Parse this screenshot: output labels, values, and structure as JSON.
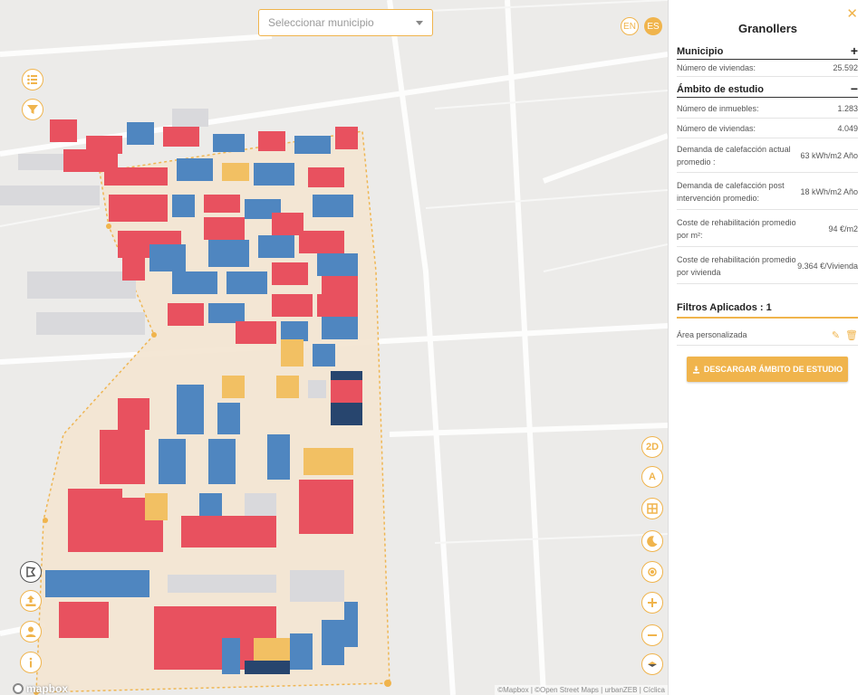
{
  "map": {
    "municipality_select": {
      "placeholder": "Seleccionar municipio"
    },
    "lang": {
      "en": "EN",
      "es": "ES"
    },
    "controls_right": {
      "mode_2d": "2D",
      "label_a": "A"
    },
    "logo": "mapbox",
    "attribution": "©Mapbox | ©Open Street Maps | urbanZEB | Cíclica",
    "building_colors": {
      "red": "#e8515f",
      "blue": "#4f86c0",
      "yellow": "#f2c063",
      "gray": "#d8d8dc",
      "darkblue": "#27456e"
    },
    "accent": "#f0b44c"
  },
  "panel": {
    "title": "Granollers",
    "municipio": {
      "heading": "Municipio",
      "toggle": "+",
      "rows": [
        {
          "label": "Número de viviendas:",
          "value": "25.592"
        }
      ]
    },
    "ambito": {
      "heading": "Ámbito de estudio",
      "toggle": "−",
      "rows": [
        {
          "label": "Número de inmuebles:",
          "value": "1.283"
        },
        {
          "label": "Número de viviendas:",
          "value": "4.049"
        },
        {
          "label": "Demanda de calefacción actual promedio :",
          "value": "63 kWh/m2  Año"
        },
        {
          "label": "Demanda de calefacción post intervención promedio:",
          "value": "18 kWh/m2  Año"
        },
        {
          "label": "Coste de rehabilitación promedio por m²:",
          "value": "94 €/m2"
        },
        {
          "label": "Coste de rehabilitación promedio por vivienda",
          "value": "9.364 €/Vivienda"
        }
      ]
    },
    "filters": {
      "heading": "Filtros Aplicados : 1",
      "items": [
        {
          "label": "Área personalizada"
        }
      ]
    },
    "download_label": "DESCARGAR ÁMBITO DE ESTUDIO"
  }
}
